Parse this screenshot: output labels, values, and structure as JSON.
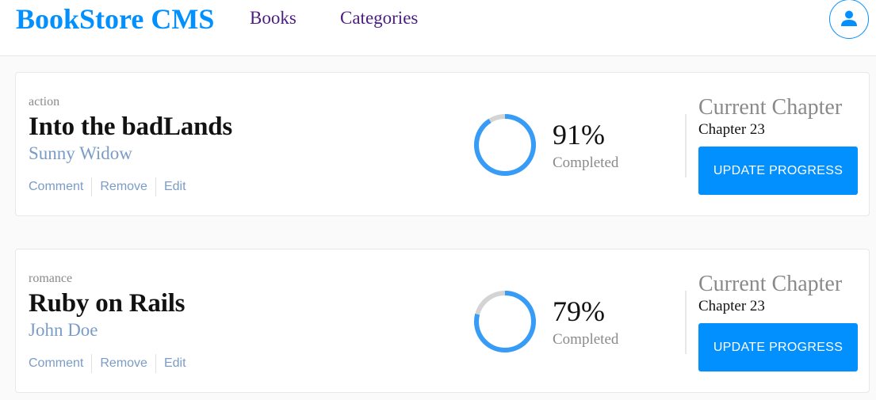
{
  "header": {
    "logo": "BookStore CMS",
    "nav": [
      {
        "label": "Books"
      },
      {
        "label": "Categories"
      }
    ],
    "user_icon": "user-icon"
  },
  "books": [
    {
      "category": "action",
      "title": "Into the badLands",
      "author": "Sunny Widow",
      "actions": [
        "Comment",
        "Remove",
        "Edit"
      ],
      "progress_percent": 91,
      "progress_label": "91%",
      "completed_label": "Completed",
      "chapter_heading": "Current Chapter",
      "chapter": "Chapter 23",
      "update_label": "UPDATE PROGRESS"
    },
    {
      "category": "romance",
      "title": "Ruby on Rails",
      "author": "John Doe",
      "actions": [
        "Comment",
        "Remove",
        "Edit"
      ],
      "progress_percent": 79,
      "progress_label": "79%",
      "completed_label": "Completed",
      "chapter_heading": "Current Chapter",
      "chapter": "Chapter 23",
      "update_label": "UPDATE PROGRESS"
    }
  ],
  "colors": {
    "brand": "#0290ff",
    "nav_link": "#4b1d7f",
    "author": "#7a9cc6",
    "progress_track": "#d4d4d4",
    "progress_fill_start": "#307bbe",
    "progress_fill_end": "#379cf6"
  }
}
